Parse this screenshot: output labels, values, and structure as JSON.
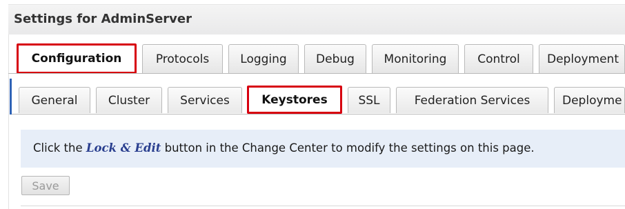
{
  "title": "Settings for AdminServer",
  "tabs": {
    "configuration": "Configuration",
    "protocols": "Protocols",
    "logging": "Logging",
    "debug": "Debug",
    "monitoring": "Monitoring",
    "control": "Control",
    "deployments": "Deployment"
  },
  "subtabs": {
    "general": "General",
    "cluster": "Cluster",
    "services": "Services",
    "keystores": "Keystores",
    "ssl": "SSL",
    "federation": "Federation Services",
    "deployment": "Deployme"
  },
  "info": {
    "prefix": "Click the ",
    "emphasis": "Lock & Edit",
    "suffix": " button in the Change Center to modify the settings on this page."
  },
  "save_label": "Save",
  "colors": {
    "highlight_border": "#d7000f",
    "info_background": "#e7eef8",
    "emphasis_text": "#2a3f8f"
  }
}
